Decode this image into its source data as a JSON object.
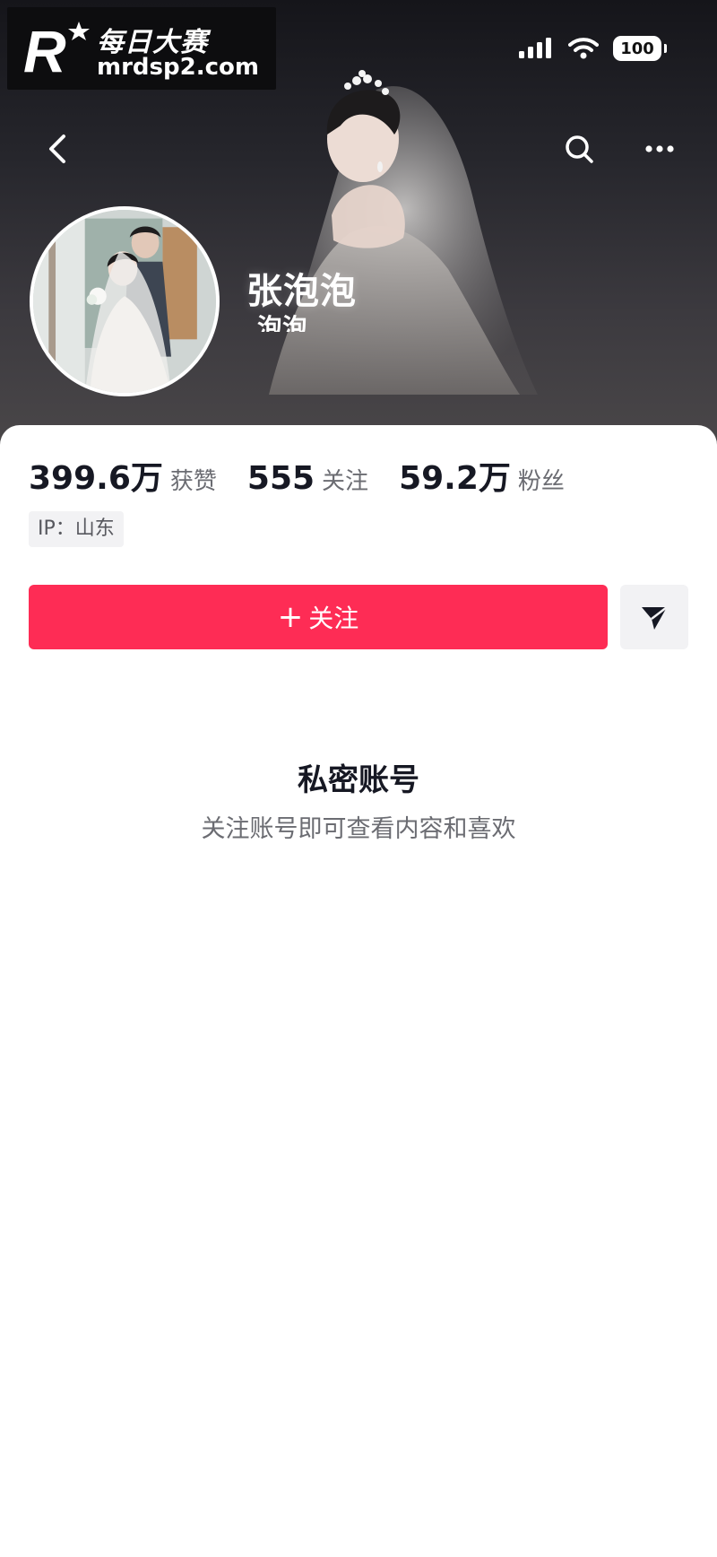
{
  "watermark": {
    "logo_letter": "R",
    "title": "每日大赛",
    "url": "mrdsp2.com"
  },
  "status_bar": {
    "battery": "100",
    "signal_icon": "signal-icon",
    "wifi_icon": "wifi-icon"
  },
  "nav": {
    "back_icon": "chevron-left-icon",
    "search_icon": "search-icon",
    "more_icon": "more-icon"
  },
  "profile": {
    "nickname": "张泡泡",
    "sub_name": "泡泡"
  },
  "stats": [
    {
      "value": "399.6万",
      "label": "获赞"
    },
    {
      "value": "555",
      "label": "关注"
    },
    {
      "value": "59.2万",
      "label": "粉丝"
    }
  ],
  "ip": "IP：山东",
  "actions": {
    "follow_plus": "+",
    "follow_label": "关注",
    "share_icon": "send-icon"
  },
  "private": {
    "title": "私密账号",
    "desc": "关注账号即可查看内容和喜欢"
  },
  "colors": {
    "accent": "#fe2c55",
    "text_primary": "#161823",
    "text_secondary": "#6b6c72",
    "chip_bg": "#f2f2f4"
  }
}
